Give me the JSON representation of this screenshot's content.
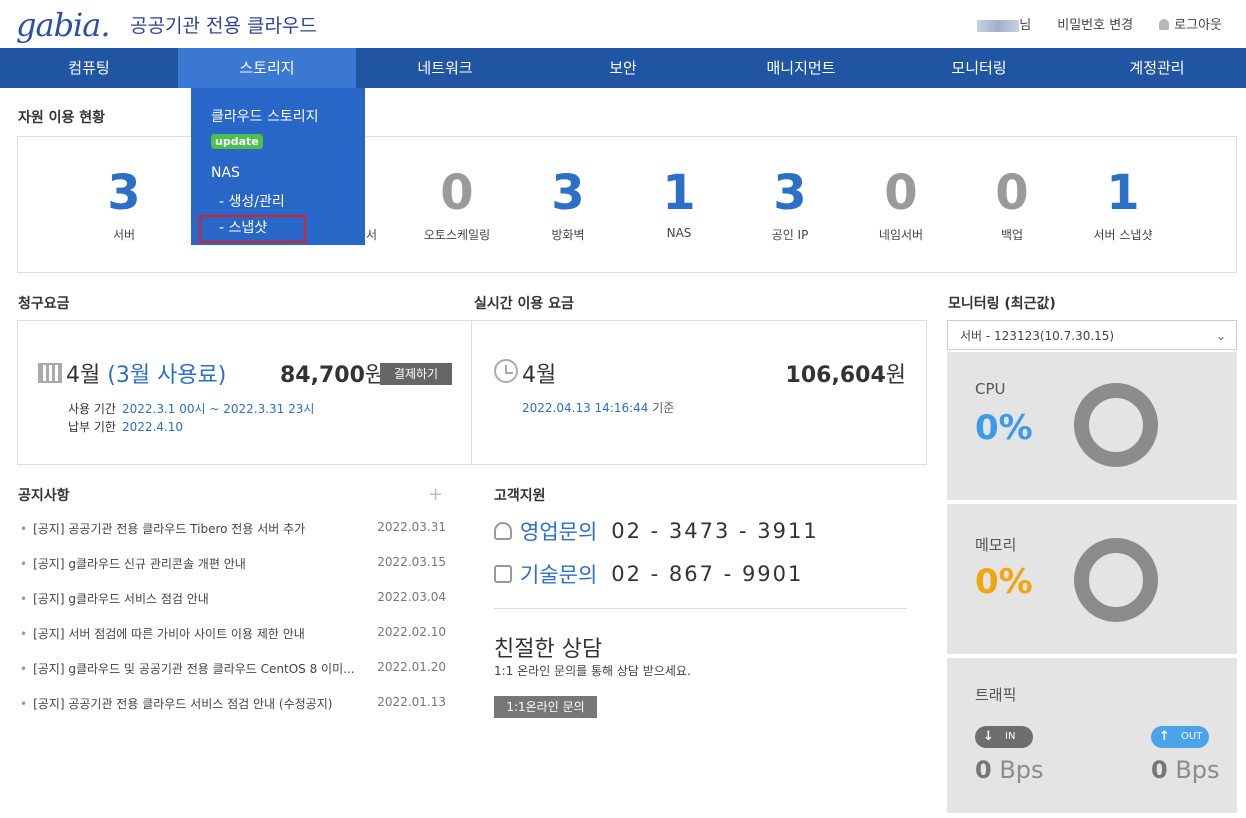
{
  "header": {
    "logo": "gabia.",
    "subtitle": "공공기관 전용 클라우드",
    "user_suffix": "님",
    "change_password": "비밀번호 변경",
    "logout": "로그아웃"
  },
  "nav": [
    "컴퓨팅",
    "스토리지",
    "네트워크",
    "보안",
    "매니지먼트",
    "모니터링",
    "계정관리"
  ],
  "dropdown": {
    "title": "클라우드 스토리지",
    "badge": "update",
    "nas": "NAS",
    "sub1": "- 생성/관리",
    "sub2": "- 스냅샷"
  },
  "usage": {
    "title": "자원 이용 현황",
    "items": [
      {
        "value": "3",
        "label": "서버"
      },
      {
        "value": "0",
        "label": "오토스케일링"
      },
      {
        "value": "3",
        "label": "방화벽"
      },
      {
        "value": "1",
        "label": "NAS"
      },
      {
        "value": "3",
        "label": "공인 IP"
      },
      {
        "value": "0",
        "label": "네임서버"
      },
      {
        "value": "0",
        "label": "백업"
      },
      {
        "value": "1",
        "label": "서버 스냅샷"
      }
    ],
    "hidden_label_tail": "서"
  },
  "billing": {
    "title": "청구요금",
    "month": "4월",
    "usage_month": "(3월 사용료)",
    "amount": "84,700",
    "currency": "원",
    "pay_button": "결제하기",
    "period_label": "사용 기간",
    "period_value": "2022.3.1 00시 ~ 2022.3.31 23시",
    "due_label": "납부 기한",
    "due_value": "2022.4.10"
  },
  "realtime": {
    "title": "실시간 이용 요금",
    "month": "4월",
    "amount": "106,604",
    "currency": "원",
    "timestamp": "2022.04.13 14:16:44",
    "timestamp_suffix": "기준"
  },
  "notice": {
    "title": "공지사항",
    "items": [
      {
        "text": "[공지] 공공기관 전용 클라우드 Tibero 전용 서버 추가",
        "date": "2022.03.31"
      },
      {
        "text": "[공지] g클라우드 신규 관리콘솔 개편 안내",
        "date": "2022.03.15"
      },
      {
        "text": "[공지] g클라우드 서비스 점검 안내",
        "date": "2022.03.04"
      },
      {
        "text": "[공지] 서버 점검에 따른 가비아 사이트 이용 제한 안내",
        "date": "2022.02.10"
      },
      {
        "text": "[공지] g클라우드 및 공공기관 전용 클라우드 CentOS 8 이미...",
        "date": "2022.01.20"
      },
      {
        "text": "[공지] 공공기관 전용 클라우드 서비스 점검 안내 (수정공지)",
        "date": "2022.01.13"
      }
    ]
  },
  "support": {
    "title": "고객지원",
    "sales_label": "영업문의",
    "sales_phone": "02 - 3473 - 3911",
    "tech_label": "기술문의",
    "tech_phone": "02 - 867 - 9901",
    "consult_title": "친절한 상담",
    "consult_desc": "1:1 온라인 문의를 통해 상담 받으세요.",
    "consult_button": "1:1온라인 문의"
  },
  "monitoring": {
    "title": "모니터링 (최근값)",
    "selected_server": "서버 - 123123(10.7.30.15)",
    "cpu_label": "CPU",
    "cpu_value": "0%",
    "cpu_percent": 0,
    "memory_label": "메모리",
    "memory_value": "0%",
    "memory_percent": 0,
    "traffic_label": "트래픽",
    "in_label": "IN",
    "out_label": "OUT",
    "in_value": "0",
    "out_value": "0",
    "unit": "Bps",
    "colors": {
      "cpu": "#3b9be8",
      "memory": "#f0a60e",
      "in_pill": "#6e6e6e",
      "out_pill": "#49a3ea"
    }
  }
}
